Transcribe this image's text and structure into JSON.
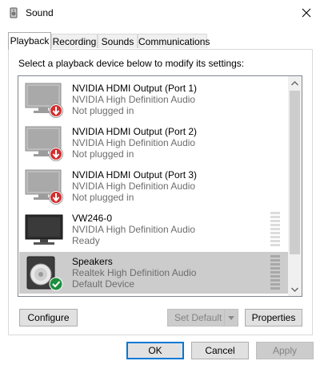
{
  "window": {
    "title": "Sound",
    "icon": "speaker-app-icon",
    "close_icon": "close-icon"
  },
  "tabs": [
    {
      "label": "Playback",
      "active": true
    },
    {
      "label": "Recording",
      "active": false
    },
    {
      "label": "Sounds",
      "active": false
    },
    {
      "label": "Communications",
      "active": false
    }
  ],
  "instruction": "Select a playback device below to modify its settings:",
  "devices": [
    {
      "name": "NVIDIA HDMI Output (Port 1)",
      "driver": "NVIDIA High Definition Audio",
      "status": "Not plugged in",
      "icon": "monitor-icon",
      "badge": "unplugged-badge",
      "selected": false
    },
    {
      "name": "NVIDIA HDMI Output (Port 2)",
      "driver": "NVIDIA High Definition Audio",
      "status": "Not plugged in",
      "icon": "monitor-icon",
      "badge": "unplugged-badge",
      "selected": false
    },
    {
      "name": "NVIDIA HDMI Output (Port 3)",
      "driver": "NVIDIA High Definition Audio",
      "status": "Not plugged in",
      "icon": "monitor-icon",
      "badge": "unplugged-badge",
      "selected": false
    },
    {
      "name": "VW246-0",
      "driver": "NVIDIA High Definition Audio",
      "status": "Ready",
      "icon": "monitor-icon",
      "badge": null,
      "selected": false
    },
    {
      "name": "Speakers",
      "driver": "Realtek High Definition Audio",
      "status": "Default Device",
      "icon": "speaker-icon",
      "badge": "default-check-badge",
      "selected": true
    }
  ],
  "buttons": {
    "configure": "Configure",
    "set_default": "Set Default",
    "properties": "Properties",
    "ok": "OK",
    "cancel": "Cancel",
    "apply": "Apply"
  },
  "colors": {
    "accent": "#0078d7",
    "selected_row": "#cccccc",
    "unplugged_badge": "#d32f2f",
    "default_badge": "#1e8e3e"
  }
}
